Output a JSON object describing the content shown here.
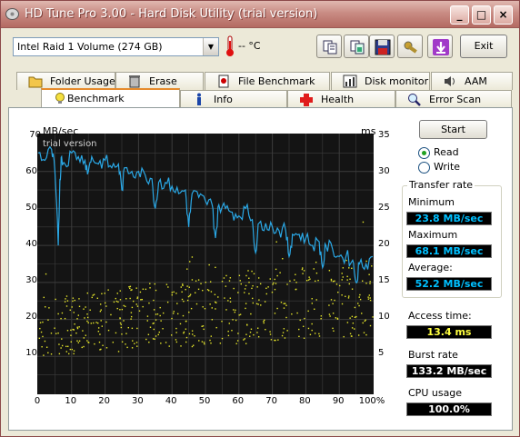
{
  "window": {
    "title": "HD Tune Pro 3.00 - Hard Disk Utility (trial version)",
    "minimize": "_",
    "maximize": "□",
    "close": "×"
  },
  "toolbar": {
    "drive": "Intel  Raid 1 Volume (274 GB)",
    "temperature": "-- °C",
    "exit_label": "Exit"
  },
  "tabs_top": [
    {
      "label": "Folder Usage",
      "icon": "folder-icon"
    },
    {
      "label": "Erase",
      "icon": "trash-icon"
    },
    {
      "label": "File Benchmark",
      "icon": "file-benchmark-icon"
    },
    {
      "label": "Disk monitor",
      "icon": "disk-monitor-icon"
    },
    {
      "label": "AAM",
      "icon": "speaker-icon"
    }
  ],
  "tabs_bottom": [
    {
      "label": "Benchmark",
      "icon": "lightbulb-icon",
      "active": true
    },
    {
      "label": "Info",
      "icon": "info-icon"
    },
    {
      "label": "Health",
      "icon": "health-cross-icon"
    },
    {
      "label": "Error Scan",
      "icon": "magnifier-icon"
    }
  ],
  "chart_data": {
    "type": "line",
    "left_unit": "MB/sec",
    "right_unit": "ms",
    "watermark": "trial version",
    "y_left_ticks": [
      "70",
      "60",
      "50",
      "40",
      "30",
      "20",
      "10"
    ],
    "y_right_ticks": [
      "35",
      "30",
      "25",
      "20",
      "15",
      "10",
      "5"
    ],
    "x_ticks": [
      "0",
      "10",
      "20",
      "30",
      "40",
      "50",
      "60",
      "70",
      "80",
      "90",
      "100%"
    ],
    "ylim": [
      0,
      70
    ],
    "y2lim": [
      0,
      35
    ],
    "xlim": [
      0,
      100
    ],
    "series": [
      {
        "color": "#2aa8e6",
        "x": [
          0,
          2,
          4,
          5,
          6,
          6.5,
          7,
          8,
          10,
          12,
          14,
          15,
          16,
          18,
          20,
          22,
          24,
          25,
          26,
          28,
          30,
          32,
          34,
          35,
          36,
          38,
          40,
          42,
          44,
          45,
          46,
          48,
          50,
          52,
          53,
          54,
          56,
          58,
          60,
          62,
          64,
          65,
          66,
          68,
          70,
          72,
          74,
          75,
          76,
          78,
          80,
          82,
          84,
          85,
          86,
          88,
          90,
          92,
          94,
          95,
          96,
          98,
          100
        ],
        "y": [
          65,
          63,
          66,
          60,
          40,
          58,
          64,
          62,
          65,
          64,
          63,
          60,
          64,
          62,
          63,
          61,
          62,
          55,
          61,
          60,
          60,
          59,
          58,
          50,
          57,
          57,
          56,
          54,
          55,
          45,
          54,
          53,
          52,
          51,
          42,
          51,
          50,
          49,
          48,
          50,
          47,
          38,
          46,
          46,
          45,
          44,
          44,
          37,
          43,
          43,
          42,
          40,
          41,
          34,
          40,
          39,
          37,
          37,
          36,
          30,
          35,
          35,
          37
        ]
      },
      {
        "color": "#e8e82a",
        "axis": "right",
        "x_range": [
          0,
          100
        ],
        "y_range_start": [
          5,
          13
        ],
        "y_range_end": [
          8,
          19
        ]
      }
    ]
  },
  "side": {
    "start_label": "Start",
    "read_label": "Read",
    "write_label": "Write",
    "read_selected": true,
    "transfer_rate_label": "Transfer rate",
    "minimum_label": "Minimum",
    "minimum": "23.8 MB/sec",
    "maximum_label": "Maximum",
    "maximum": "68.1 MB/sec",
    "average_label": "Average:",
    "average": "52.2 MB/sec",
    "access_time_label": "Access time:",
    "access_time": "13.4 ms",
    "burst_rate_label": "Burst rate",
    "burst_rate": "133.2 MB/sec",
    "cpu_usage_label": "CPU usage",
    "cpu_usage": "100.0%"
  },
  "colors": {
    "value_cyan": "#00c0ff",
    "value_yellow": "#ffff40",
    "value_white": "#ffffff",
    "chart_bg": "#141414",
    "grid": "#3c3c3c"
  }
}
